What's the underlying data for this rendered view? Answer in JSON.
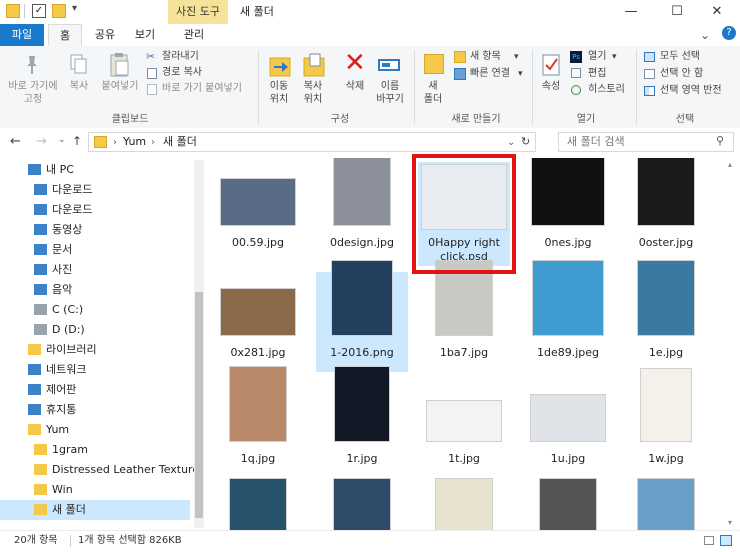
{
  "titlebar": {
    "context_tab": "사진 도구",
    "title": "새 폴더",
    "minimize_glyph": "—",
    "maximize_glyph": "☐",
    "close_glyph": "✕",
    "expand_glyph": "⌄",
    "help_glyph": "?"
  },
  "tabs": [
    "파일",
    "홈",
    "공유",
    "보기",
    "관리"
  ],
  "ribbon": {
    "clipboard": {
      "pin": "바로 가기에\n고정",
      "copy": "복사",
      "paste": "붙여넣기",
      "cut": "잘라내기",
      "copy_path": "경로 복사",
      "paste_shortcut": "바로 가기 붙여넣기",
      "group": "클립보드"
    },
    "organize": {
      "move_to": "이동\n위치",
      "copy_to": "복사\n위치",
      "delete": "삭제",
      "rename": "이름\n바꾸기",
      "group": "구성"
    },
    "new": {
      "new_folder": "새\n폴더",
      "new_item": "새 항목",
      "easy_access": "빠른 연결",
      "group": "새로 만들기"
    },
    "open": {
      "properties": "속성",
      "open": "열기",
      "edit": "편집",
      "history": "히스토리",
      "group": "열기"
    },
    "select": {
      "select_all": "모두 선택",
      "select_none": "선택 안 함",
      "invert": "선택 영역 반전",
      "group": "선택"
    }
  },
  "address": {
    "path": [
      "Yum",
      "새 폴더"
    ],
    "search_placeholder": "새 폴더 검색"
  },
  "nav": [
    {
      "label": "내 PC",
      "icon": "pc-icon"
    },
    {
      "label": "다운로드",
      "icon": "download-icon"
    },
    {
      "label": "다운로드",
      "icon": "desktop-icon"
    },
    {
      "label": "동영상",
      "icon": "video-icon"
    },
    {
      "label": "문서",
      "icon": "document-icon"
    },
    {
      "label": "사진",
      "icon": "picture-icon"
    },
    {
      "label": "음악",
      "icon": "music-icon"
    },
    {
      "label": "C (C:)",
      "icon": "drive-icon"
    },
    {
      "label": "D (D:)",
      "icon": "drive-icon"
    },
    {
      "label": "라이브러리",
      "icon": "library-icon"
    },
    {
      "label": "네트워크",
      "icon": "network-icon"
    },
    {
      "label": "제어판",
      "icon": "control-panel-icon"
    },
    {
      "label": "휴지통",
      "icon": "recycle-bin-icon"
    },
    {
      "label": "Yum",
      "icon": "folder-icon"
    },
    {
      "label": "1gram",
      "icon": "folder-icon"
    },
    {
      "label": "Distressed Leather Textures",
      "icon": "folder-icon"
    },
    {
      "label": "Win",
      "icon": "folder-icon"
    },
    {
      "label": "새 폴더",
      "icon": "folder-icon"
    }
  ],
  "files": [
    {
      "name": "00.59.jpg",
      "color": "#5a6b86"
    },
    {
      "name": "0design.jpg",
      "color": "#8a8f99"
    },
    {
      "name": "0Happy right click.psd",
      "color": "#e9edf1"
    },
    {
      "name": "0nes.jpg",
      "color": "#111111"
    },
    {
      "name": "0oster.jpg",
      "color": "#1a1a1a"
    },
    {
      "name": "0x281.jpg",
      "color": "#8a6a4a"
    },
    {
      "name": "1-2016.png",
      "color": "#23415e"
    },
    {
      "name": "1ba7.jpg",
      "color": "#c9c9c4"
    },
    {
      "name": "1de89.jpeg",
      "color": "#3f9bd0"
    },
    {
      "name": "1e.jpg",
      "color": "#3b7aa0"
    },
    {
      "name": "1q.jpg",
      "color": "#b98a6a"
    },
    {
      "name": "1r.jpg",
      "color": "#121826"
    },
    {
      "name": "1t.jpg",
      "color": "#f3f3f3"
    },
    {
      "name": "1u.jpg",
      "color": "#dfe3e8"
    },
    {
      "name": "1w.jpg",
      "color": "#f4f1ea"
    },
    {
      "name": "",
      "color": "#26526b"
    },
    {
      "name": "",
      "color": "#304a6a"
    },
    {
      "name": "",
      "color": "#e7e3d0"
    },
    {
      "name": "",
      "color": "#555555"
    },
    {
      "name": "",
      "color": "#6aa0c8"
    }
  ],
  "status": {
    "count": "20개 항목",
    "selected": "1개 항목 선택함 826KB"
  },
  "colors": {
    "accent": "#1979ca",
    "highlight": "#e01414",
    "selection": "#cce8ff"
  }
}
